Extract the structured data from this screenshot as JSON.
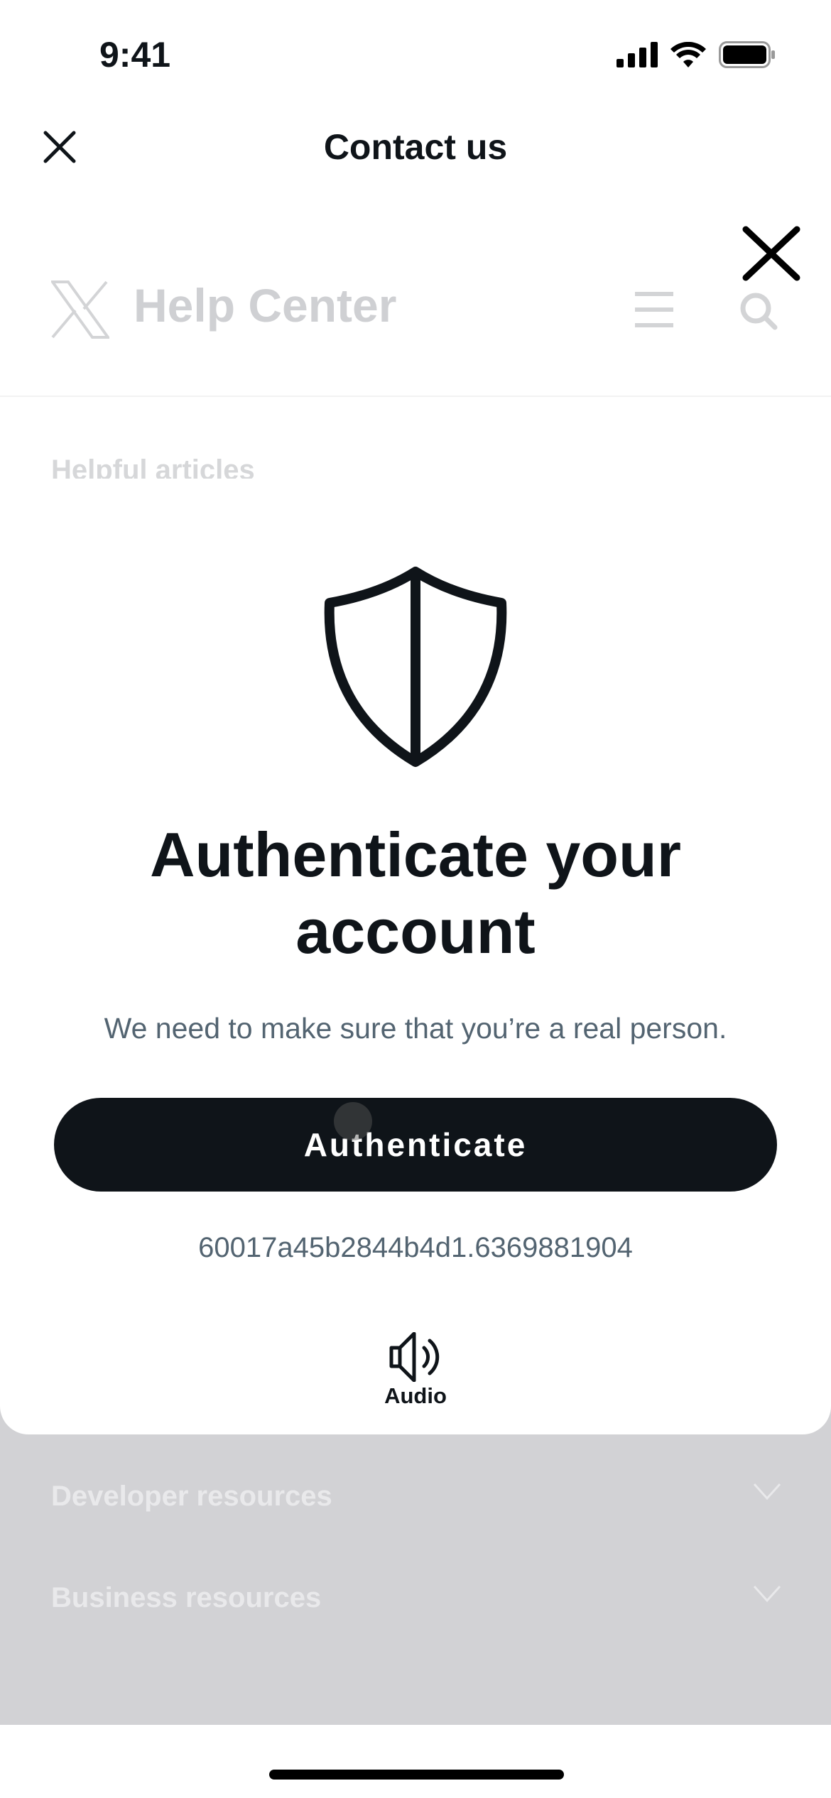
{
  "status_bar": {
    "time": "9:41"
  },
  "nav": {
    "title": "Contact us"
  },
  "help_center": {
    "title": "Help Center",
    "sections": [
      "Helpful articles",
      "Developer resources",
      "Business resources"
    ]
  },
  "modal": {
    "title_line1": "Authenticate your",
    "title_line2": "account",
    "subtitle": "We need to make sure that you’re a real person.",
    "button_label": "Authenticate",
    "session_code": "60017a45b2844b4d1.6369881904",
    "audio_label": "Audio"
  },
  "colors": {
    "button_bg": "#0f1419",
    "secondary_text": "#536471",
    "overlay": "#d2d2d5"
  }
}
